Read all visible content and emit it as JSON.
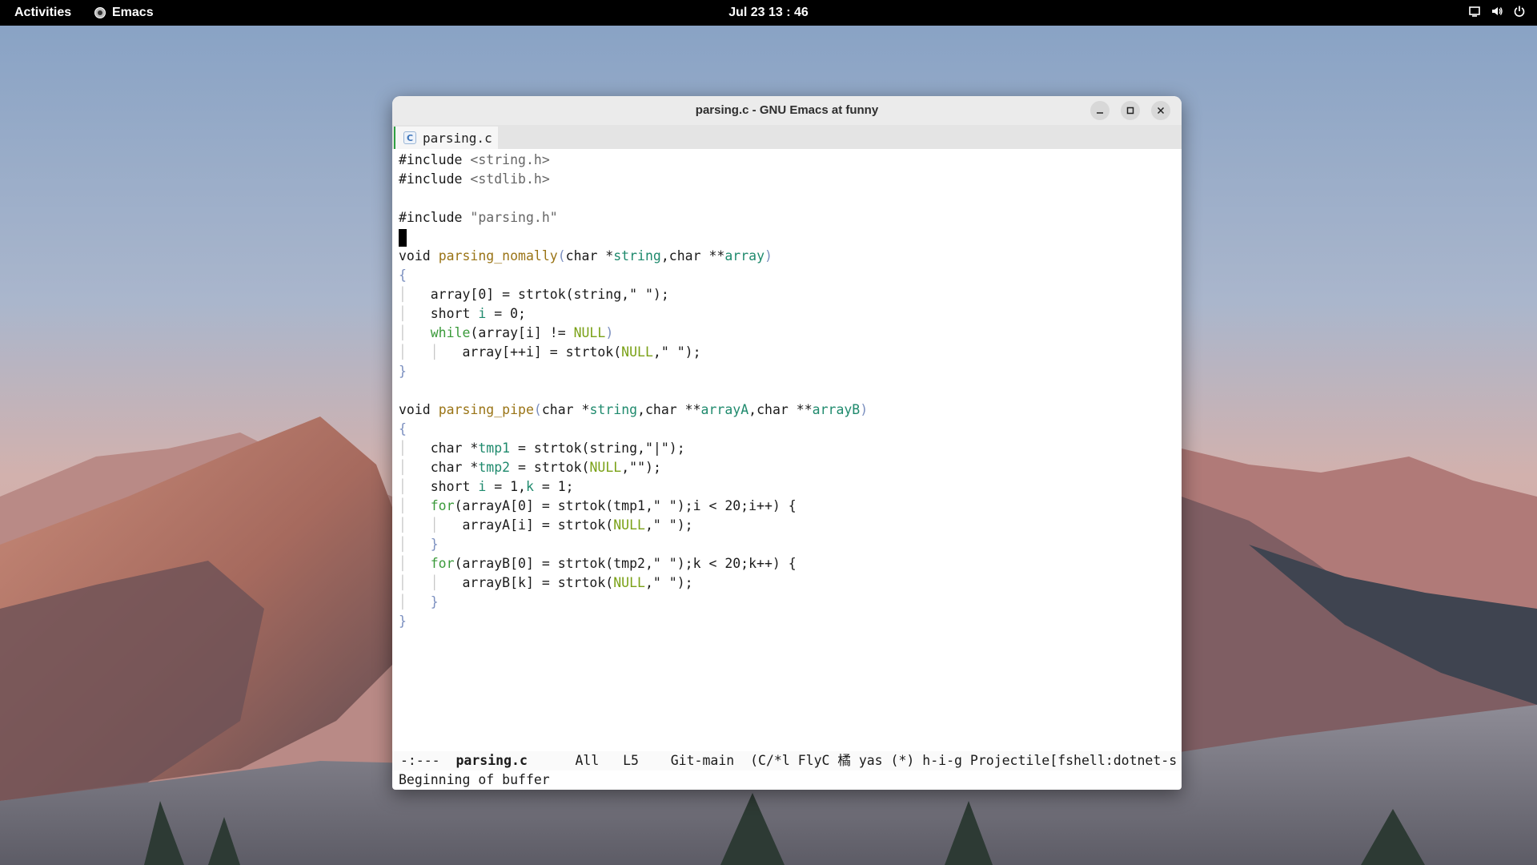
{
  "topbar": {
    "activities": "Activities",
    "app_name": "Emacs",
    "clock": "Jul 23  13 : 46",
    "tray_icons": [
      "screen-icon",
      "volume-icon",
      "power-icon"
    ]
  },
  "window": {
    "title": "parsing.c - GNU Emacs at funny",
    "tab_label": "parsing.c",
    "tab_icon": "c-file-icon"
  },
  "code": {
    "line1_kw": "#include",
    "line1_rest": " <string.h>",
    "line2_kw": "#include",
    "line2_rest": " <stdlib.h>",
    "line4_kw": "#include",
    "line4_rest": " \"parsing.h\"",
    "f1_ret": "void",
    "f1_name": "parsing_nomally",
    "f1_p_open": "(",
    "f1_t1": "char *",
    "f1_a1": "string",
    "f1_t2": ",char **",
    "f1_a2": "array",
    "f1_p_close": ")",
    "open_brace": "{",
    "close_brace": "}",
    "f1_l1": "array[0] = strtok(string,\" \");",
    "f1_l2a": "short ",
    "f1_l2v": "i",
    "f1_l2b": " = 0;",
    "f1_l3a": "while",
    "f1_l3b": "(array[i] != ",
    "f1_l3n": "NULL",
    "f1_l3c": ")",
    "f1_l4a": "array[++i] = strtok(",
    "f1_l4n": "NULL",
    "f1_l4b": ",\" \");",
    "f2_ret": "void",
    "f2_name": "parsing_pipe",
    "f2_p_open": "(",
    "f2_t1": "char *",
    "f2_a1": "string",
    "f2_t2": ",char **",
    "f2_a2": "arrayA",
    "f2_t3": ",char **",
    "f2_a3": "arrayB",
    "f2_p_close": ")",
    "f2_l1a": "char *",
    "f2_l1v": "tmp1",
    "f2_l1b": " = strtok(string,\"|\");",
    "f2_l2a": "char *",
    "f2_l2v": "tmp2",
    "f2_l2b": " = strtok(",
    "f2_l2n": "NULL",
    "f2_l2c": ",\"\");",
    "f2_l3a": "short ",
    "f2_l3v": "i",
    "f2_l3b": " = 1,",
    "f2_l3v2": "k",
    "f2_l3c": " = 1;",
    "f2_l4a": "for",
    "f2_l4b": "(arrayA[0] = strtok(tmp1,\" \");i < 20;i++) {",
    "f2_l5a": "arrayA[i] = strtok(",
    "f2_l5n": "NULL",
    "f2_l5b": ",\" \");",
    "f2_l6": "}",
    "f2_l7a": "for",
    "f2_l7b": "(arrayB[0] = strtok(tmp2,\" \");k < 20;k++) {",
    "f2_l8a": "arrayB[k] = strtok(",
    "f2_l8n": "NULL",
    "f2_l8b": ",\" \");",
    "f2_l9": "}"
  },
  "modeline": {
    "status": "-:---",
    "buffer_name": "parsing.c",
    "position": "All",
    "line": "L5",
    "vc": "Git-main",
    "modes": "(C/*l FlyC 橘 yas (*) h-i-g Projectile[fshell:dotnet-s"
  },
  "echo_area": "Beginning of buffer"
}
